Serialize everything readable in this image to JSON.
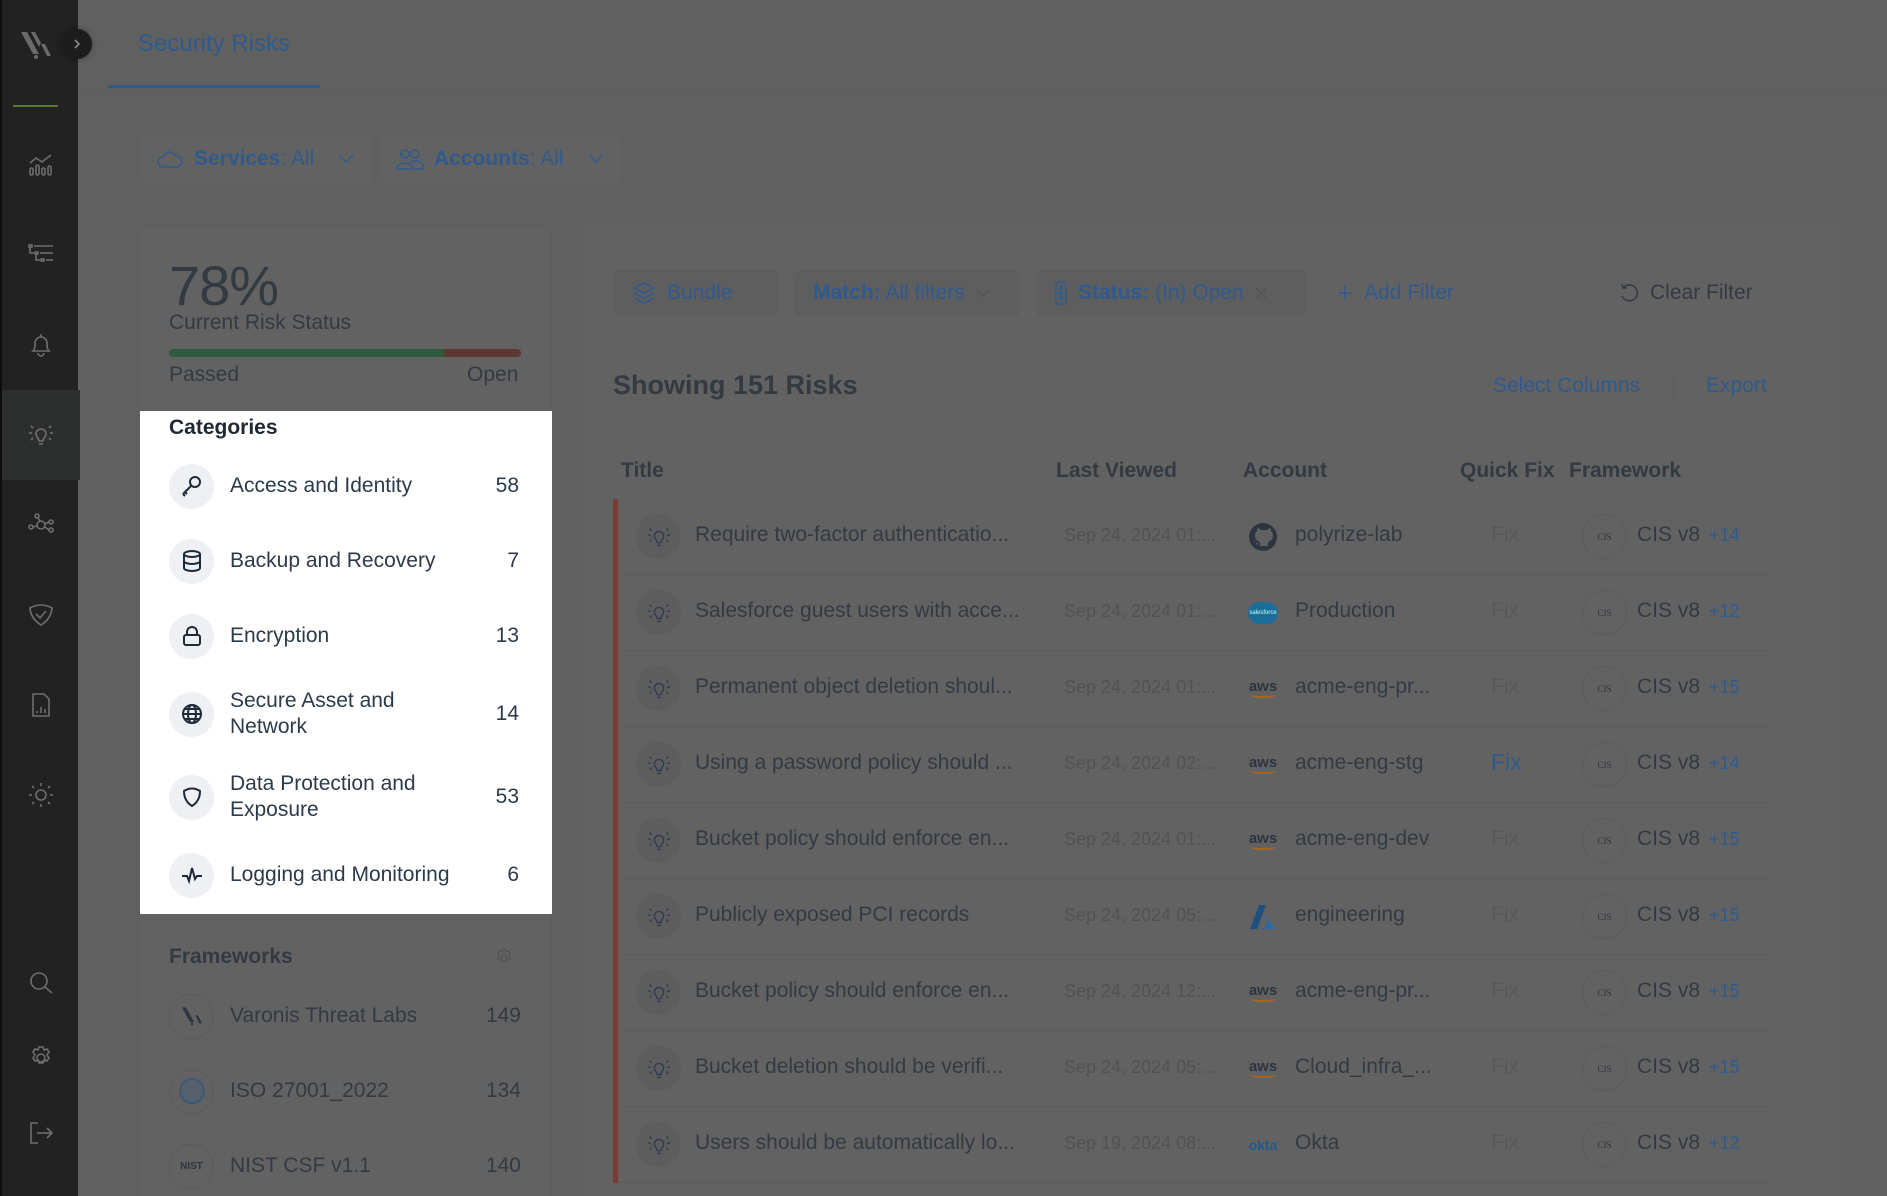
{
  "sidebar": {
    "items": [
      {
        "icon": "analytics-icon",
        "active": false
      },
      {
        "icon": "hierarchy-list-icon",
        "active": false
      },
      {
        "icon": "bell-icon",
        "active": false
      },
      {
        "icon": "lightbulb-icon",
        "active": true
      },
      {
        "icon": "network-nodes-icon",
        "active": false
      },
      {
        "icon": "shield-check-icon",
        "active": false
      },
      {
        "icon": "report-file-icon",
        "active": false
      },
      {
        "icon": "sun-icon",
        "active": false
      }
    ],
    "bottom_items": [
      {
        "icon": "search-icon"
      },
      {
        "icon": "gear-icon"
      },
      {
        "icon": "logout-icon"
      }
    ]
  },
  "tabs": [
    {
      "label": "Security Risks",
      "active": true
    }
  ],
  "scope_filters": {
    "services": {
      "label": "Services",
      "value": "All"
    },
    "accounts": {
      "label": "Accounts",
      "value": "All"
    }
  },
  "risk_status": {
    "percent_label": "78%",
    "passed_fraction": 0.78,
    "label": "Current Risk Status",
    "passed_label": "Passed",
    "open_label": "Open"
  },
  "categories": {
    "title": "Categories",
    "items": [
      {
        "label": "Access and Identity",
        "count": "58",
        "icon": "key-icon"
      },
      {
        "label": "Backup and Recovery",
        "count": "7",
        "icon": "database-icon"
      },
      {
        "label": "Encryption",
        "count": "13",
        "icon": "lock-icon"
      },
      {
        "label": "Secure Asset and Network",
        "count": "14",
        "icon": "globe-icon"
      },
      {
        "label": "Data Protection and Exposure",
        "count": "53",
        "icon": "shield-icon"
      },
      {
        "label": "Logging and Monitoring",
        "count": "6",
        "icon": "pulse-icon"
      }
    ]
  },
  "frameworks": {
    "title": "Frameworks",
    "items": [
      {
        "label": "Varonis Threat Labs",
        "count": "149",
        "icon": "varonis-logo-icon"
      },
      {
        "label": "ISO 27001_2022",
        "count": "134",
        "icon": "iso-seal-icon"
      },
      {
        "label": "NIST CSF v1.1",
        "count": "140",
        "icon": "nist-logo-icon"
      }
    ]
  },
  "filter_bar": {
    "bundle_label": "Bundle",
    "match_label": "Match:",
    "match_value": "All filters",
    "status_label": "Status:",
    "status_value": "(In) Open",
    "add_filter_label": "Add Filter",
    "clear_filter_label": "Clear Filter"
  },
  "table": {
    "showing_label": "Showing 151 Risks",
    "select_columns_label": "Select Columns",
    "export_label": "Export",
    "columns": [
      "Title",
      "Last Viewed",
      "Account",
      "Quick Fix",
      "Framework"
    ],
    "severity_color": "#7a3b36",
    "rows": [
      {
        "title": "Require two-factor authenticatio...",
        "last_viewed": "Sep 24, 2024 01:...",
        "account_type": "github",
        "account": "polyrize-lab",
        "fix": "Fix",
        "fix_enabled": false,
        "framework": "CIS v8",
        "more": "+14"
      },
      {
        "title": "Salesforce guest users with acce...",
        "last_viewed": "Sep 24, 2024 01:...",
        "account_type": "salesforce",
        "account": "Production",
        "fix": "Fix",
        "fix_enabled": false,
        "framework": "CIS v8",
        "more": "+12"
      },
      {
        "title": "Permanent object deletion shoul...",
        "last_viewed": "Sep 24, 2024 01:...",
        "account_type": "aws",
        "account": "acme-eng-pr...",
        "fix": "Fix",
        "fix_enabled": false,
        "framework": "CIS v8",
        "more": "+15"
      },
      {
        "title": "Using a password policy should ...",
        "last_viewed": "Sep 24, 2024 02:...",
        "account_type": "aws",
        "account": "acme-eng-stg",
        "fix": "Fix",
        "fix_enabled": true,
        "framework": "CIS v8",
        "more": "+14"
      },
      {
        "title": "Bucket policy should enforce en...",
        "last_viewed": "Sep 24, 2024 01:...",
        "account_type": "aws",
        "account": "acme-eng-dev",
        "fix": "Fix",
        "fix_enabled": false,
        "framework": "CIS v8",
        "more": "+15"
      },
      {
        "title": "Publicly exposed PCI records",
        "last_viewed": "Sep 24, 2024 05:...",
        "account_type": "azure",
        "account": "engineering",
        "fix": "Fix",
        "fix_enabled": false,
        "framework": "CIS v8",
        "more": "+15"
      },
      {
        "title": "Bucket policy should enforce en...",
        "last_viewed": "Sep 24, 2024 12:...",
        "account_type": "aws",
        "account": "acme-eng-pr...",
        "fix": "Fix",
        "fix_enabled": false,
        "framework": "CIS v8",
        "more": "+15"
      },
      {
        "title": "Bucket deletion should be verifi...",
        "last_viewed": "Sep 24, 2024 05:...",
        "account_type": "aws",
        "account": "Cloud_infra_...",
        "fix": "Fix",
        "fix_enabled": false,
        "framework": "CIS v8",
        "more": "+15"
      },
      {
        "title": "Users should be automatically lo...",
        "last_viewed": "Sep 19, 2024 08:...",
        "account_type": "okta",
        "account": "Okta",
        "fix": "Fix",
        "fix_enabled": false,
        "framework": "CIS v8",
        "more": "+12"
      }
    ]
  },
  "logos": {
    "aws_text": "aws",
    "okta_text": "okta",
    "salesforce_text": "salesforce",
    "cis_text": "CIS",
    "nist_text": "NIST",
    "iso_text": "ISO"
  }
}
